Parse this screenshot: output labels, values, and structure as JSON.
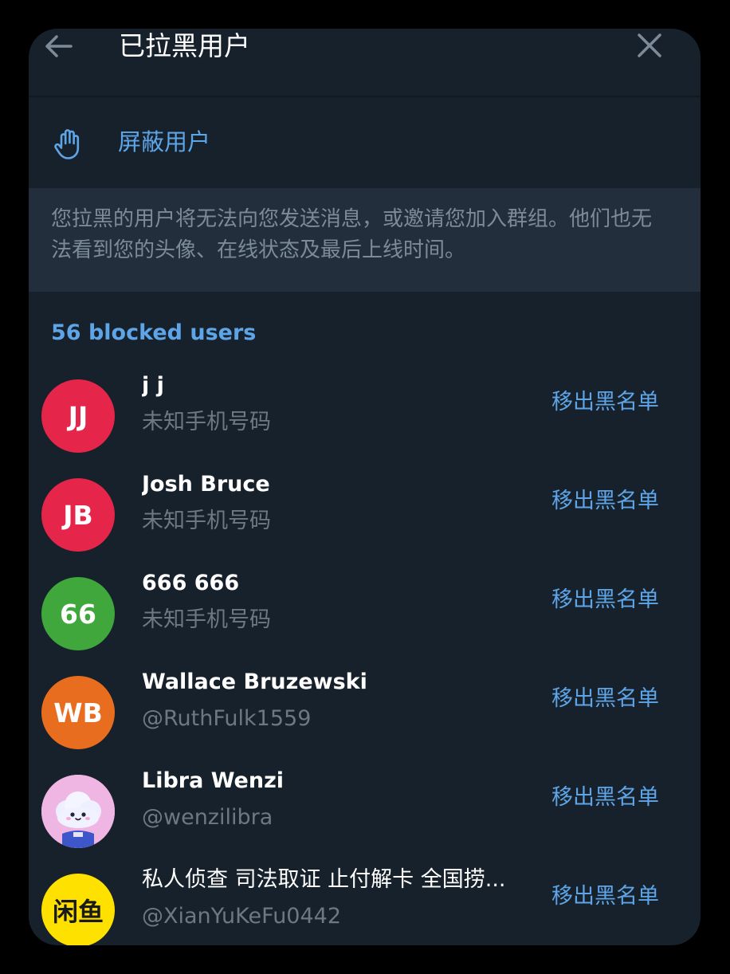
{
  "header": {
    "title": "已拉黑用户",
    "back_icon": "arrow-left-icon",
    "close_icon": "close-icon"
  },
  "block_action": {
    "icon": "hand-stop-icon",
    "label": "屏蔽用户"
  },
  "info": {
    "text": "您拉黑的用户将无法向您发送消息，或邀请您加入群组。他们也无法看到您的头像、在线状态及最后上线时间。"
  },
  "count_label": "56 blocked users",
  "unblock_label": "移出黑名单",
  "users": [
    {
      "initials": "JJ",
      "name": "j j",
      "sub": "未知手机号码",
      "color": "#e5264a"
    },
    {
      "initials": "JB",
      "name": "Josh Bruce",
      "sub": "未知手机号码",
      "color": "#e5264a"
    },
    {
      "initials": "66",
      "name": "666 666",
      "sub": "未知手机号码",
      "color": "#3fa73c"
    },
    {
      "initials": "WB",
      "name": "Wallace Bruzewski",
      "sub": "@RuthFulk1559",
      "color": "#e96d1f"
    },
    {
      "initials": "",
      "name": "Libra Wenzi",
      "sub": "@wenzilibra",
      "color": "#f3b8e6"
    },
    {
      "initials": "闲鱼",
      "name": "私人侦查 司法取证 止付解卡 全国捞...",
      "sub": "@XianYuKeFu0442",
      "color": "#ffe100"
    }
  ],
  "colors": {
    "background": "#17212b",
    "accent": "#5ea5e8",
    "info_bg": "#232e3c",
    "secondary_text": "#6d7883"
  }
}
